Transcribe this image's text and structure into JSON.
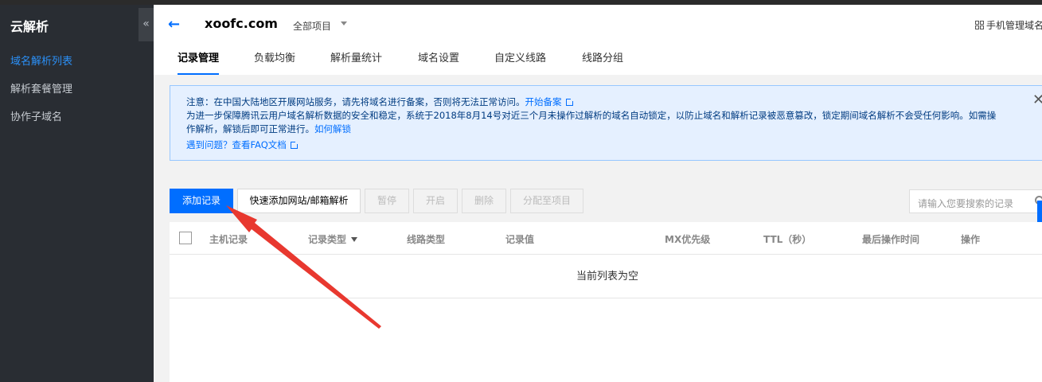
{
  "sidebar": {
    "title": "云解析",
    "collapse_glyph": "«",
    "items": [
      {
        "label": "域名解析列表",
        "active": true
      },
      {
        "label": "解析套餐管理",
        "active": false
      },
      {
        "label": "协作子域名",
        "active": false
      }
    ]
  },
  "header": {
    "back_glyph": "←",
    "domain": "xoofc.com",
    "project": "全部项目",
    "mobile_manage": "手机管理域名",
    "tabs": [
      {
        "label": "记录管理",
        "active": true
      },
      {
        "label": "负载均衡",
        "active": false
      },
      {
        "label": "解析量统计",
        "active": false
      },
      {
        "label": "域名设置",
        "active": false
      },
      {
        "label": "自定义线路",
        "active": false
      },
      {
        "label": "线路分组",
        "active": false
      }
    ]
  },
  "notice": {
    "line1_text": "注意：在中国大陆地区开展网站服务，请先将域名进行备案，否则将无法正常访问。",
    "line1_link": "开始备案",
    "line2_text": "为进一步保障腾讯云用户域名解析数据的安全和稳定，系统于2018年8月14号对近三个月未操作过解析的域名自动锁定，以防止域名和解析记录被恶意篡改，锁定期间域名解析不会受任何影响。如需操",
    "line3_text": "作解析，解锁后即可正常进行。",
    "line3_link": "如何解锁",
    "line4_link": "遇到问题？查看FAQ文档",
    "close_glyph": "✕"
  },
  "toolbar": {
    "add_record": "添加记录",
    "quick_add": "快速添加网站/邮箱解析",
    "pause": "暂停",
    "enable": "开启",
    "delete": "删除",
    "assign_project": "分配至项目",
    "search_placeholder": "请输入您要搜索的记录"
  },
  "table": {
    "columns": [
      "主机记录",
      "记录类型",
      "线路类型",
      "记录值",
      "MX优先级",
      "TTL（秒）",
      "最后操作时间",
      "操作"
    ],
    "empty_text": "当前列表为空"
  },
  "colors": {
    "accent": "#006eff",
    "sidebar_bg": "#292d33",
    "annotation_arrow": "#e8382f"
  }
}
